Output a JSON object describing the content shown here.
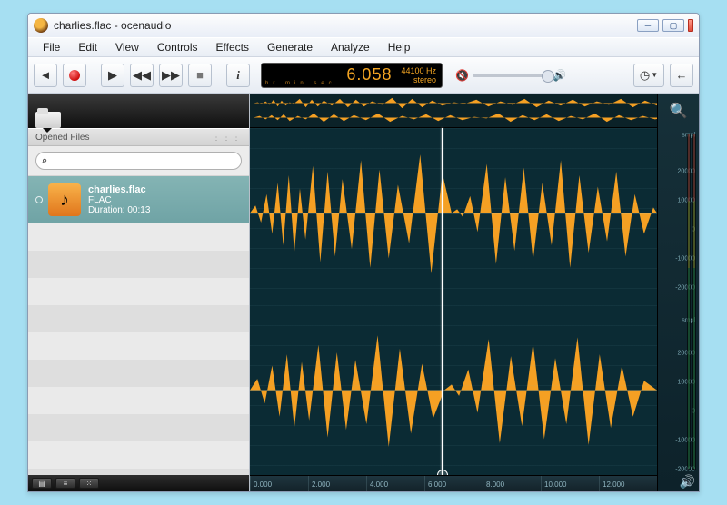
{
  "title": "charlies.flac - ocenaudio",
  "menu": [
    "File",
    "Edit",
    "View",
    "Controls",
    "Effects",
    "Generate",
    "Analyze",
    "Help"
  ],
  "time": {
    "value": "6.058",
    "labels": "hr  min sec",
    "sample_rate": "44100 Hz",
    "channels": "stereo"
  },
  "sidebar": {
    "header": "Opened Files",
    "search_placeholder": "",
    "file": {
      "name": "charlies.flac",
      "format": "FLAC",
      "duration": "Duration: 00:13"
    }
  },
  "scale": {
    "unit": "smpl",
    "ticks": [
      "20000",
      "10000",
      "0",
      "-10000",
      "-20000"
    ]
  },
  "ruler": [
    "0.000",
    "2.000",
    "4.000",
    "6.000",
    "8.000",
    "10.000",
    "12.000"
  ],
  "icons": {
    "search": "⌕",
    "play": "▶",
    "rew": "◀◀",
    "ff": "▶▶",
    "stop": "■",
    "back": "◄",
    "info": "i",
    "mute": "🔇",
    "vol": "🔊",
    "clock": "◷",
    "larr": "←",
    "zoom": "🔍"
  }
}
